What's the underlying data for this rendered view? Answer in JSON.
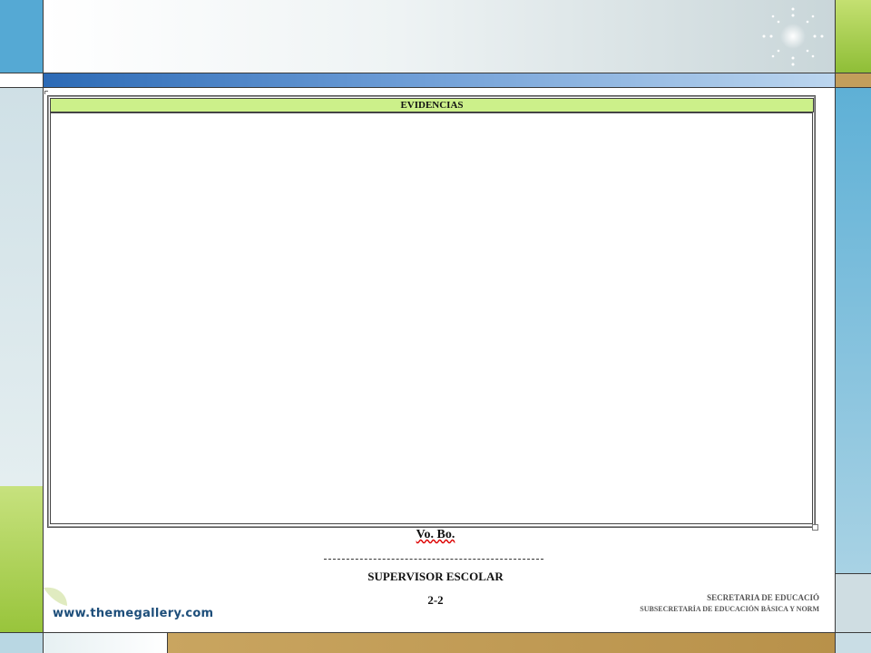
{
  "document": {
    "table_header": "EVIDENCIAS",
    "approval_label": "Vo. Bo.",
    "signature_title": "SUPERVISOR ESCOLAR",
    "page_number": "2-2"
  },
  "footer_org": {
    "line1": "SECRETARIA DE EDUCACIÓ",
    "line2": "SUBSECRETARÍA DE EDUCACIÓN BÁSICA Y NORM"
  },
  "template": {
    "website": "www.themegallery.com"
  },
  "colors": {
    "accent_blue": "#2c6ab6",
    "accent_green": "#98c43b",
    "accent_gold": "#c29e5b",
    "table_header_fill": "#ccf08a"
  },
  "icons": {
    "sparkle": "sparkle-icon",
    "leaf": "leaf-icon"
  }
}
